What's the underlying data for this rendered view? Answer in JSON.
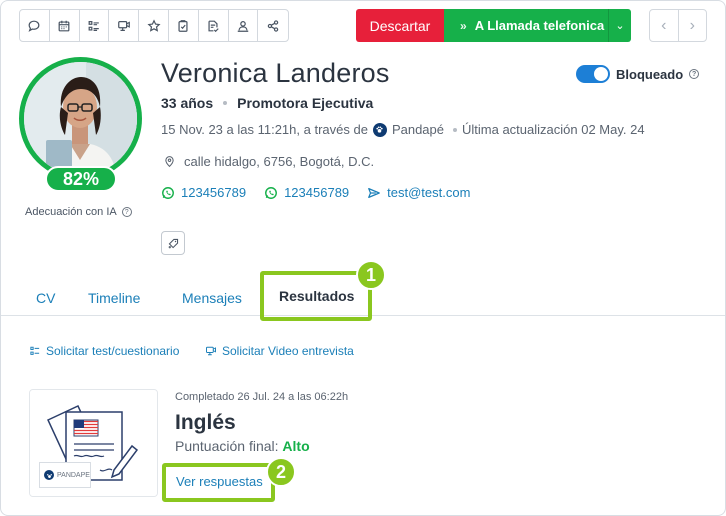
{
  "toolbar": {
    "icons": [
      "chat-icon",
      "calendar-icon",
      "list-icon",
      "video-icon",
      "star-icon",
      "clipboard-icon",
      "doc-check-icon",
      "user-search-icon",
      "share-icon"
    ]
  },
  "actions": {
    "discard_label": "Descartar",
    "move_label": "A Llamada telefonica",
    "prev_label": "‹",
    "next_label": "›"
  },
  "candidate": {
    "name": "Veronica Landeros",
    "age": "33 años",
    "position": "Promotora Ejecutiva",
    "created_prefix": "15 Nov. 23 a las 11:21h, a través de",
    "source": "Pandapé",
    "updated": "Última actualización 02 May. 24",
    "address": "calle hidalgo, 6756, Bogotá, D.C.",
    "phone1": "123456789",
    "phone2": "123456789",
    "email": "test@test.com",
    "score": "82%",
    "score_value": 82,
    "score_label": "Adecuación con IA",
    "blocked_label": "Bloqueado",
    "blocked": true
  },
  "tabs": [
    {
      "label": "CV"
    },
    {
      "label": "Timeline"
    },
    {
      "label": "Mensajes"
    },
    {
      "label": "Resultados"
    }
  ],
  "links": {
    "request_test": "Solicitar test/cuestionario",
    "request_video": "Solicitar Video entrevista"
  },
  "result": {
    "completed": "Completado 26 Jul. 24 a las 06:22h",
    "title": "Inglés",
    "score_prefix": "Puntuación final:",
    "score_value": "Alto",
    "view_label": "Ver respuestas",
    "logo_text": "PANDAPE"
  },
  "callouts": [
    "1",
    "2"
  ],
  "colors": {
    "green": "#16b04a",
    "red": "#e7203a",
    "link": "#1b7fb8",
    "highlight": "#8ac71f",
    "toggle": "#1d7fd6"
  }
}
